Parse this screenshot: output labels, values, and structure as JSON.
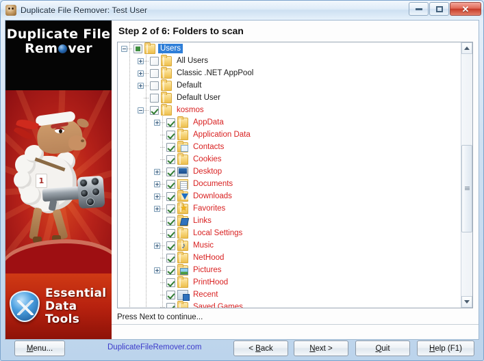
{
  "window": {
    "title": "Duplicate File Remover: Test User",
    "icon": "sheep-icon",
    "controls": {
      "minimize": "minimize-icon",
      "maximize": "maximize-icon",
      "close": "✕"
    }
  },
  "banner": {
    "brand_line1": "Duplicate File",
    "brand_line2_a": "Rem",
    "brand_line2_b": "ver",
    "logo_dot": "blue-sphere",
    "mascot": "sheep-with-minigun",
    "tag_number": "1",
    "company_line1": "Essential",
    "company_line2": "Data Tools",
    "company_badge": "shield-tools-icon"
  },
  "main": {
    "step_title": "Step 2 of 6: Folders to scan",
    "status": "Press Next to continue..."
  },
  "tree": {
    "rows": [
      {
        "label": "Users",
        "indent": 0,
        "expander": "minus",
        "check": "partial",
        "icon": "folder",
        "color": "dark",
        "selected": true
      },
      {
        "label": "All Users",
        "indent": 1,
        "expander": "plus",
        "check": "empty",
        "icon": "folder",
        "color": "dark",
        "selected": false
      },
      {
        "label": "Classic .NET AppPool",
        "indent": 1,
        "expander": "plus",
        "check": "empty",
        "icon": "folder",
        "color": "dark",
        "selected": false
      },
      {
        "label": "Default",
        "indent": 1,
        "expander": "plus",
        "check": "empty",
        "icon": "folder",
        "color": "dark",
        "selected": false
      },
      {
        "label": "Default User",
        "indent": 1,
        "expander": "none",
        "check": "empty",
        "icon": "folder",
        "color": "dark",
        "selected": false
      },
      {
        "label": "kosmos",
        "indent": 1,
        "expander": "minus",
        "check": "checked",
        "icon": "folder",
        "color": "red",
        "selected": false
      },
      {
        "label": "AppData",
        "indent": 2,
        "expander": "plus",
        "check": "checked",
        "icon": "folder",
        "color": "red",
        "selected": false
      },
      {
        "label": "Application Data",
        "indent": 2,
        "expander": "none",
        "check": "checked",
        "icon": "folder",
        "color": "red",
        "selected": false
      },
      {
        "label": "Contacts",
        "indent": 2,
        "expander": "none",
        "check": "checked",
        "icon": "contacts",
        "color": "red",
        "selected": false
      },
      {
        "label": "Cookies",
        "indent": 2,
        "expander": "none",
        "check": "checked",
        "icon": "folder",
        "color": "red",
        "selected": false
      },
      {
        "label": "Desktop",
        "indent": 2,
        "expander": "plus",
        "check": "checked",
        "icon": "desktop",
        "color": "red",
        "selected": false
      },
      {
        "label": "Documents",
        "indent": 2,
        "expander": "plus",
        "check": "checked",
        "icon": "docs",
        "color": "red",
        "selected": false
      },
      {
        "label": "Downloads",
        "indent": 2,
        "expander": "plus",
        "check": "checked",
        "icon": "downloads",
        "color": "red",
        "selected": false
      },
      {
        "label": "Favorites",
        "indent": 2,
        "expander": "plus",
        "check": "checked",
        "icon": "fav",
        "color": "red",
        "selected": false
      },
      {
        "label": "Links",
        "indent": 2,
        "expander": "none",
        "check": "checked",
        "icon": "links",
        "color": "red",
        "selected": false
      },
      {
        "label": "Local Settings",
        "indent": 2,
        "expander": "none",
        "check": "checked",
        "icon": "folder",
        "color": "red",
        "selected": false
      },
      {
        "label": "Music",
        "indent": 2,
        "expander": "plus",
        "check": "checked",
        "icon": "music",
        "color": "red",
        "selected": false
      },
      {
        "label": "NetHood",
        "indent": 2,
        "expander": "none",
        "check": "checked",
        "icon": "folder",
        "color": "red",
        "selected": false
      },
      {
        "label": "Pictures",
        "indent": 2,
        "expander": "plus",
        "check": "checked",
        "icon": "pictures",
        "color": "red",
        "selected": false
      },
      {
        "label": "PrintHood",
        "indent": 2,
        "expander": "none",
        "check": "checked",
        "icon": "folder",
        "color": "red",
        "selected": false
      },
      {
        "label": "Recent",
        "indent": 2,
        "expander": "none",
        "check": "checked",
        "icon": "recent",
        "color": "red",
        "selected": false
      },
      {
        "label": "Saved Games",
        "indent": 2,
        "expander": "none",
        "check": "checked",
        "icon": "folder",
        "color": "red",
        "selected": false
      }
    ],
    "scrollbar": {
      "up": "scroll-up-arrow",
      "down": "scroll-down-arrow"
    }
  },
  "footer": {
    "menu": "Menu...",
    "link": "DuplicateFileRemover.com",
    "back_pre": "< ",
    "back_key": "B",
    "back_post": "ack",
    "next_key": "N",
    "next_post": "ext >",
    "quit_key": "Q",
    "quit_post": "uit",
    "help_key": "H",
    "help_post": "elp (F1)",
    "menu_key": "M",
    "menu_pre": "",
    "menu_post": "enu..."
  },
  "colors": {
    "link": "#3b39c9",
    "selected_bg": "#2f7fd8",
    "tree_red": "#d81f1f",
    "brand_red": "#b8220f",
    "close_red": "#c63b28"
  }
}
